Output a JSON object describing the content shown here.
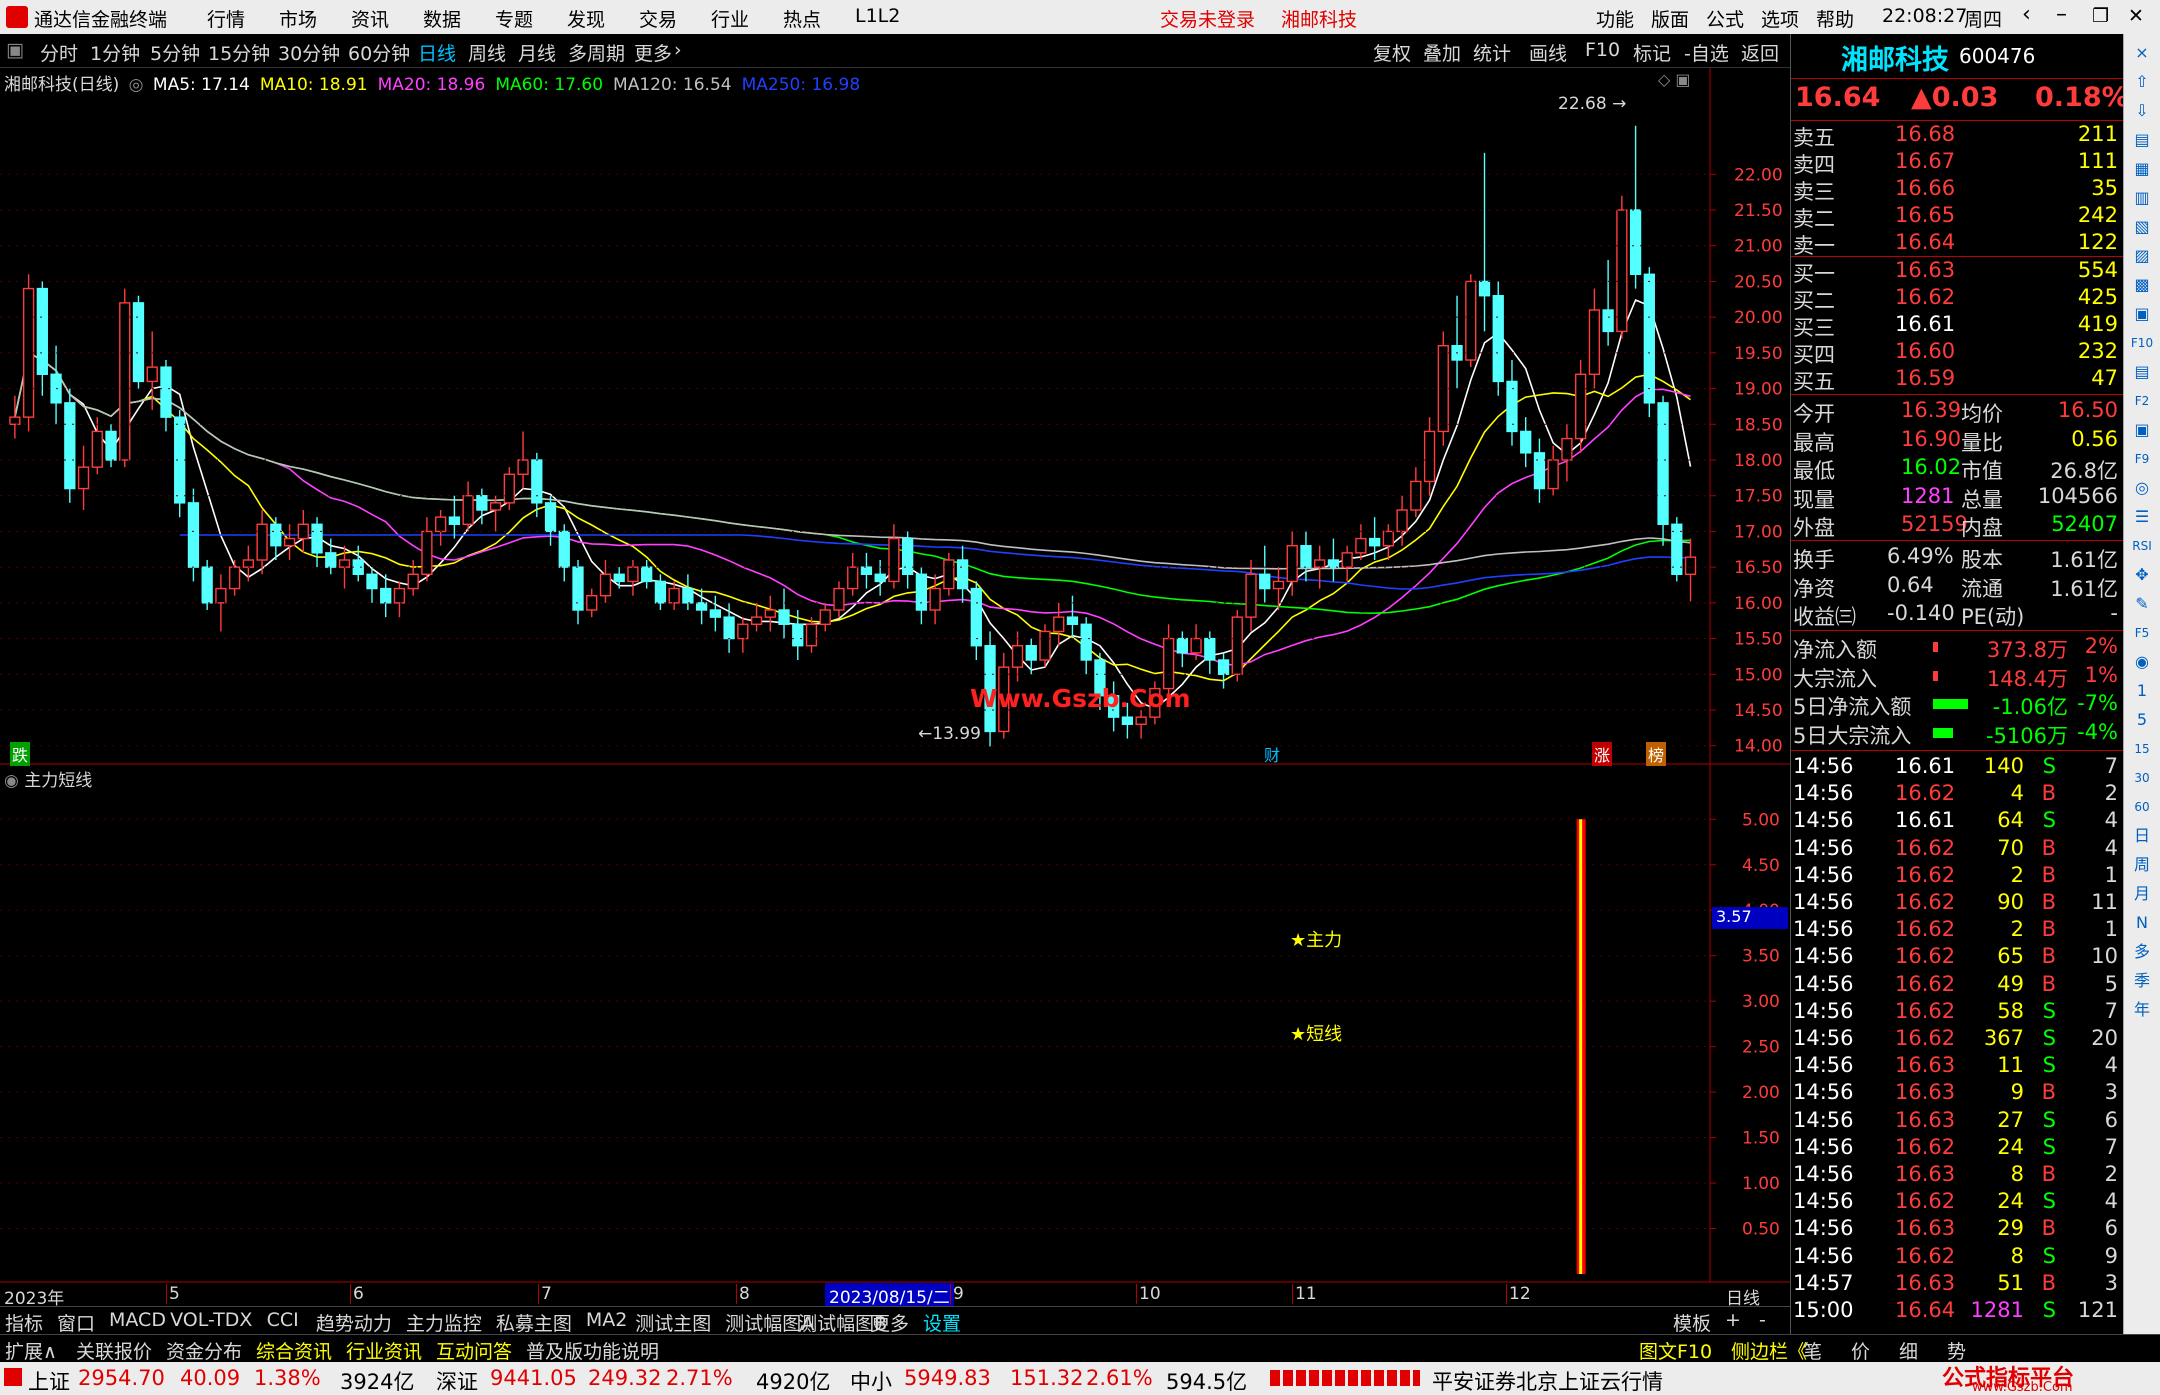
{
  "app": {
    "title": "通达信金融终端",
    "menus": [
      "行情",
      "市场",
      "资讯",
      "数据",
      "专题",
      "发现",
      "交易",
      "行业",
      "热点",
      "L1L2"
    ],
    "trade_status": "交易未登录",
    "stock_name_title": "湘邮科技",
    "right_menus": [
      "功能",
      "版面",
      "公式",
      "选项",
      "帮助"
    ],
    "time": "22:08:27",
    "weekday": "周四"
  },
  "periods": {
    "items": [
      "分时",
      "1分钟",
      "5分钟",
      "15分钟",
      "30分钟",
      "60分钟",
      "日线",
      "周线",
      "月线",
      "多周期",
      "更多"
    ],
    "active": "日线"
  },
  "toolbar_right": [
    "复权",
    "叠加",
    "统计",
    "画线",
    "F10",
    "标记",
    "-自选",
    "返回"
  ],
  "chart_header": {
    "title": "湘邮科技(日线)",
    "ma": [
      {
        "label": "MA5: 17.14",
        "color": "#ffffff"
      },
      {
        "label": "MA10: 18.91",
        "color": "#ffff00"
      },
      {
        "label": "MA20: 18.96",
        "color": "#ff40ff"
      },
      {
        "label": "MA60: 17.60",
        "color": "#00ff00"
      },
      {
        "label": "MA120: 16.54",
        "color": "#c0c0c0"
      },
      {
        "label": "MA250: 16.98",
        "color": "#2040ff"
      }
    ]
  },
  "price_axis": [
    "22.00",
    "21.50",
    "21.00",
    "20.50",
    "20.00",
    "19.50",
    "19.00",
    "18.50",
    "18.00",
    "17.50",
    "17.00",
    "16.50",
    "16.00",
    "15.50",
    "15.00",
    "14.50",
    "14.00"
  ],
  "annotations": {
    "high": "22.68",
    "low": "13.99",
    "watermark": "Www.Gszb.Com",
    "mark_die": "跌",
    "mark_cai": "财",
    "mark_zhang": "涨",
    "mark_bang": "榜"
  },
  "indicator": {
    "title": "主力短线",
    "axis": [
      "5.00",
      "4.50",
      "4.00",
      "3.50",
      "3.00",
      "2.50",
      "2.00",
      "1.50",
      "1.00",
      "0.50"
    ],
    "current": "3.57",
    "label1": "★主力",
    "label2": "★短线"
  },
  "date_axis": {
    "start": "2023年",
    "months": [
      "5",
      "6",
      "7",
      "8",
      "9",
      "10",
      "11",
      "12"
    ],
    "selected": "2023/08/15/二",
    "period_label": "日线"
  },
  "quote": {
    "name": "湘邮科技",
    "code": "600476",
    "price": "16.64",
    "change": "▲0.03",
    "pct": "0.18%",
    "asks": [
      {
        "label": "卖五",
        "price": "16.68",
        "vol": "211"
      },
      {
        "label": "卖四",
        "price": "16.67",
        "vol": "111"
      },
      {
        "label": "卖三",
        "price": "16.66",
        "vol": "35"
      },
      {
        "label": "卖二",
        "price": "16.65",
        "vol": "242"
      },
      {
        "label": "卖一",
        "price": "16.64",
        "vol": "122"
      }
    ],
    "bids": [
      {
        "label": "买一",
        "price": "16.63",
        "vol": "554"
      },
      {
        "label": "买二",
        "price": "16.62",
        "vol": "425"
      },
      {
        "label": "买三",
        "price": "16.61",
        "vol": "419"
      },
      {
        "label": "买四",
        "price": "16.60",
        "vol": "232"
      },
      {
        "label": "买五",
        "price": "16.59",
        "vol": "47"
      }
    ],
    "stats": [
      {
        "l1": "今开",
        "v1": "16.39",
        "c1": "r",
        "l2": "均价",
        "v2": "16.50",
        "c2": "r"
      },
      {
        "l1": "最高",
        "v1": "16.90",
        "c1": "r",
        "l2": "量比",
        "v2": "0.56",
        "c2": "y"
      },
      {
        "l1": "最低",
        "v1": "16.02",
        "c1": "g",
        "l2": "市值",
        "v2": "26.8亿",
        "c2": "w"
      },
      {
        "l1": "现量",
        "v1": "1281",
        "c1": "m",
        "l2": "总量",
        "v2": "104566",
        "c2": "w"
      },
      {
        "l1": "外盘",
        "v1": "52159",
        "c1": "r",
        "l2": "内盘",
        "v2": "52407",
        "c2": "g"
      }
    ],
    "stats2": [
      {
        "l1": "换手",
        "v1": "6.49%",
        "c1": "w",
        "l2": "股本",
        "v2": "1.61亿",
        "c2": "w"
      },
      {
        "l1": "净资",
        "v1": "0.64",
        "c1": "w",
        "l2": "流通",
        "v2": "1.61亿",
        "c2": "w"
      },
      {
        "l1": "收益㈢",
        "v1": "-0.140",
        "c1": "w",
        "l2": "PE(动)",
        "v2": "-",
        "c2": "w"
      }
    ],
    "flows": [
      {
        "label": "净流入额",
        "val": "373.8万",
        "pct": "2%",
        "color": "#ff3c3c",
        "bar": 0.1
      },
      {
        "label": "大宗流入",
        "val": "148.4万",
        "pct": "1%",
        "color": "#ff3c3c",
        "bar": 0.1
      },
      {
        "label": "5日净流入额",
        "val": "-1.06亿",
        "pct": "-7%",
        "color": "#00ff00",
        "bar": 0.7
      },
      {
        "label": "5日大宗流入",
        "val": "-5106万",
        "pct": "-4%",
        "color": "#00ff00",
        "bar": 0.4
      }
    ],
    "ticks": [
      [
        "14:56",
        "16.61",
        "140",
        "S",
        "7"
      ],
      [
        "14:56",
        "16.62",
        "4",
        "B",
        "2"
      ],
      [
        "14:56",
        "16.61",
        "64",
        "S",
        "4"
      ],
      [
        "14:56",
        "16.62",
        "70",
        "B",
        "4"
      ],
      [
        "14:56",
        "16.62",
        "2",
        "B",
        "1"
      ],
      [
        "14:56",
        "16.62",
        "90",
        "B",
        "11"
      ],
      [
        "14:56",
        "16.62",
        "2",
        "B",
        "1"
      ],
      [
        "14:56",
        "16.62",
        "65",
        "B",
        "10"
      ],
      [
        "14:56",
        "16.62",
        "49",
        "B",
        "5"
      ],
      [
        "14:56",
        "16.62",
        "58",
        "S",
        "7"
      ],
      [
        "14:56",
        "16.62",
        "367",
        "S",
        "20"
      ],
      [
        "14:56",
        "16.63",
        "11",
        "S",
        "4"
      ],
      [
        "14:56",
        "16.63",
        "9",
        "B",
        "3"
      ],
      [
        "14:56",
        "16.63",
        "27",
        "S",
        "6"
      ],
      [
        "14:56",
        "16.62",
        "24",
        "S",
        "7"
      ],
      [
        "14:56",
        "16.63",
        "8",
        "B",
        "2"
      ],
      [
        "14:56",
        "16.62",
        "24",
        "S",
        "4"
      ],
      [
        "14:56",
        "16.63",
        "29",
        "B",
        "6"
      ],
      [
        "14:56",
        "16.62",
        "8",
        "S",
        "9"
      ],
      [
        "14:57",
        "16.63",
        "51",
        "B",
        "3"
      ],
      [
        "15:00",
        "16.64",
        "1281",
        "S",
        "121"
      ]
    ]
  },
  "icon_strip": [
    "×",
    "⇧",
    "⇩",
    "▤",
    "▦",
    "▥",
    "▧",
    "▨",
    "▩",
    "▣",
    "F10",
    "▤",
    "F2",
    "▣",
    "F9",
    "◎",
    "☰",
    "RSI",
    "✥",
    "✎",
    "F5",
    "◉",
    "1",
    "5",
    "15",
    "30",
    "60",
    "日",
    "周",
    "月",
    "N",
    "多",
    "季",
    "年"
  ],
  "bottom_tabs": {
    "items": [
      "指标",
      "窗口",
      "MACD",
      "VOL-TDX",
      "CCI",
      "趋势动力",
      "主力监控",
      "私募主图",
      "MA2",
      "测试主图",
      "测试幅图A",
      "测试幅图B",
      "更多",
      "设置"
    ],
    "active": "设置",
    "right": [
      "模板",
      "+",
      "-"
    ]
  },
  "bottom_tabs2": {
    "items": [
      "扩展∧",
      "关联报价",
      "资金分布",
      "综合资讯",
      "行业资讯",
      "互动问答",
      "普及版功能说明"
    ],
    "right": [
      "图文F10",
      "侧边栏《",
      "笔",
      "价",
      "细",
      "势"
    ]
  },
  "status": {
    "sh_label": "上证",
    "sh": "2954.70",
    "sh_chg": "40.09",
    "sh_pct": "1.38%",
    "sh_amt": "3924亿",
    "sz_label": "深证",
    "sz": "9441.05",
    "sz_chg": "249.32",
    "sz_pct": "2.71%",
    "sz_amt": "4920亿",
    "zx_label": "中小",
    "zx": "5949.83",
    "zx_chg": "151.32",
    "zx_pct": "2.61%",
    "zx_amt": "594.5亿",
    "server": "平安证券北京上证云行情",
    "brand": "公式指标平台",
    "brand_url": "www.Gszb.Com"
  },
  "chart_data": {
    "type": "candlestick",
    "title": "湘邮科技(日线)",
    "ylim": [
      13.8,
      22.9
    ],
    "ohlc": [
      [
        18.5,
        18.9,
        18.3,
        18.6
      ],
      [
        18.6,
        20.6,
        18.4,
        20.4
      ],
      [
        20.4,
        20.5,
        18.9,
        19.2
      ],
      [
        19.2,
        19.6,
        18.5,
        18.8
      ],
      [
        18.8,
        19.0,
        17.4,
        17.6
      ],
      [
        17.6,
        18.2,
        17.3,
        17.9
      ],
      [
        17.9,
        18.6,
        17.8,
        18.4
      ],
      [
        18.4,
        18.5,
        17.9,
        18.0
      ],
      [
        18.0,
        20.4,
        17.9,
        20.2
      ],
      [
        20.2,
        20.3,
        19.0,
        19.1
      ],
      [
        19.1,
        19.8,
        18.7,
        19.3
      ],
      [
        19.3,
        19.4,
        18.4,
        18.6
      ],
      [
        18.6,
        18.7,
        17.2,
        17.4
      ],
      [
        17.4,
        17.6,
        16.3,
        16.5
      ],
      [
        16.5,
        16.6,
        15.9,
        16.0
      ],
      [
        16.0,
        16.4,
        15.6,
        16.2
      ],
      [
        16.2,
        16.6,
        16.1,
        16.5
      ],
      [
        16.5,
        16.8,
        16.3,
        16.6
      ],
      [
        16.6,
        17.3,
        16.4,
        17.1
      ],
      [
        17.1,
        17.2,
        16.6,
        16.8
      ],
      [
        16.8,
        17.1,
        16.6,
        16.9
      ],
      [
        16.9,
        17.3,
        16.7,
        17.1
      ],
      [
        17.1,
        17.2,
        16.5,
        16.7
      ],
      [
        16.7,
        16.9,
        16.4,
        16.5
      ],
      [
        16.5,
        16.8,
        16.2,
        16.6
      ],
      [
        16.6,
        16.8,
        16.3,
        16.4
      ],
      [
        16.4,
        16.5,
        16.0,
        16.2
      ],
      [
        16.2,
        16.4,
        15.8,
        16.0
      ],
      [
        16.0,
        16.3,
        15.8,
        16.2
      ],
      [
        16.2,
        16.6,
        16.1,
        16.4
      ],
      [
        16.4,
        17.2,
        16.3,
        17.0
      ],
      [
        17.0,
        17.3,
        16.8,
        17.2
      ],
      [
        17.2,
        17.5,
        16.9,
        17.1
      ],
      [
        17.1,
        17.7,
        17.0,
        17.5
      ],
      [
        17.5,
        17.6,
        17.1,
        17.3
      ],
      [
        17.3,
        17.5,
        17.0,
        17.4
      ],
      [
        17.4,
        17.9,
        17.3,
        17.8
      ],
      [
        17.8,
        18.4,
        17.6,
        18.0
      ],
      [
        18.0,
        18.1,
        17.2,
        17.4
      ],
      [
        17.4,
        17.5,
        16.8,
        17.0
      ],
      [
        17.0,
        17.1,
        16.3,
        16.5
      ],
      [
        16.5,
        16.6,
        15.7,
        15.9
      ],
      [
        15.9,
        16.2,
        15.8,
        16.1
      ],
      [
        16.1,
        16.6,
        16.0,
        16.4
      ],
      [
        16.4,
        16.5,
        16.2,
        16.3
      ],
      [
        16.3,
        16.6,
        16.1,
        16.5
      ],
      [
        16.5,
        16.6,
        16.2,
        16.3
      ],
      [
        16.3,
        16.4,
        15.9,
        16.0
      ],
      [
        16.0,
        16.3,
        15.9,
        16.2
      ],
      [
        16.2,
        16.4,
        15.9,
        16.0
      ],
      [
        16.0,
        16.2,
        15.7,
        15.9
      ],
      [
        15.9,
        16.1,
        15.6,
        15.8
      ],
      [
        15.8,
        16.0,
        15.3,
        15.5
      ],
      [
        15.5,
        15.8,
        15.3,
        15.7
      ],
      [
        15.7,
        16.0,
        15.6,
        15.8
      ],
      [
        15.8,
        16.1,
        15.6,
        15.9
      ],
      [
        15.9,
        16.2,
        15.5,
        15.7
      ],
      [
        15.7,
        15.9,
        15.2,
        15.4
      ],
      [
        15.4,
        15.8,
        15.3,
        15.7
      ],
      [
        15.7,
        16.0,
        15.6,
        15.9
      ],
      [
        15.9,
        16.3,
        15.8,
        16.2
      ],
      [
        16.2,
        16.7,
        16.1,
        16.5
      ],
      [
        16.5,
        16.7,
        16.2,
        16.4
      ],
      [
        16.4,
        16.6,
        16.1,
        16.3
      ],
      [
        16.3,
        17.1,
        16.2,
        16.9
      ],
      [
        16.9,
        17.0,
        16.2,
        16.4
      ],
      [
        16.4,
        16.5,
        15.7,
        15.9
      ],
      [
        15.9,
        16.4,
        15.7,
        16.2
      ],
      [
        16.2,
        16.7,
        16.1,
        16.6
      ],
      [
        16.6,
        16.8,
        16.0,
        16.2
      ],
      [
        16.2,
        16.3,
        15.2,
        15.4
      ],
      [
        15.4,
        15.6,
        13.99,
        14.2
      ],
      [
        14.2,
        15.3,
        14.1,
        15.1
      ],
      [
        15.1,
        15.6,
        14.9,
        15.4
      ],
      [
        15.4,
        15.5,
        15.0,
        15.2
      ],
      [
        15.2,
        15.7,
        15.1,
        15.6
      ],
      [
        15.6,
        16.0,
        15.4,
        15.8
      ],
      [
        15.8,
        16.1,
        15.5,
        15.7
      ],
      [
        15.7,
        15.8,
        15.0,
        15.2
      ],
      [
        15.2,
        15.3,
        14.5,
        14.7
      ],
      [
        14.7,
        14.9,
        14.2,
        14.4
      ],
      [
        14.4,
        14.6,
        14.1,
        14.3
      ],
      [
        14.3,
        14.5,
        14.1,
        14.4
      ],
      [
        14.4,
        14.9,
        14.3,
        14.8
      ],
      [
        14.8,
        15.7,
        14.6,
        15.5
      ],
      [
        15.5,
        15.6,
        15.1,
        15.3
      ],
      [
        15.3,
        15.7,
        15.2,
        15.5
      ],
      [
        15.5,
        15.6,
        15.0,
        15.2
      ],
      [
        15.2,
        15.3,
        14.8,
        15.0
      ],
      [
        15.0,
        15.9,
        14.9,
        15.8
      ],
      [
        15.8,
        16.6,
        15.6,
        16.4
      ],
      [
        16.4,
        16.8,
        16.0,
        16.2
      ],
      [
        16.2,
        16.5,
        15.9,
        16.3
      ],
      [
        16.3,
        17.0,
        16.1,
        16.8
      ],
      [
        16.8,
        17.0,
        16.3,
        16.5
      ],
      [
        16.5,
        16.8,
        16.2,
        16.6
      ],
      [
        16.6,
        16.9,
        16.3,
        16.5
      ],
      [
        16.5,
        16.8,
        16.3,
        16.7
      ],
      [
        16.7,
        17.1,
        16.6,
        16.9
      ],
      [
        16.9,
        17.2,
        16.6,
        16.8
      ],
      [
        16.8,
        17.1,
        16.6,
        17.0
      ],
      [
        17.0,
        17.5,
        16.8,
        17.3
      ],
      [
        17.3,
        17.9,
        17.2,
        17.7
      ],
      [
        17.7,
        18.6,
        17.5,
        18.4
      ],
      [
        18.4,
        19.8,
        18.2,
        19.6
      ],
      [
        19.6,
        20.3,
        19.0,
        19.4
      ],
      [
        19.4,
        20.6,
        19.3,
        20.5
      ],
      [
        20.5,
        22.3,
        19.8,
        20.3
      ],
      [
        20.3,
        20.5,
        18.9,
        19.1
      ],
      [
        19.1,
        19.4,
        18.2,
        18.4
      ],
      [
        18.4,
        18.6,
        17.9,
        18.1
      ],
      [
        18.1,
        18.3,
        17.4,
        17.6
      ],
      [
        17.6,
        18.2,
        17.5,
        18.0
      ],
      [
        18.0,
        18.5,
        17.7,
        18.3
      ],
      [
        18.3,
        19.4,
        18.1,
        19.2
      ],
      [
        19.2,
        20.4,
        19.0,
        20.1
      ],
      [
        20.1,
        20.8,
        19.6,
        19.8
      ],
      [
        19.8,
        21.7,
        19.7,
        21.5
      ],
      [
        21.5,
        22.68,
        20.4,
        20.6
      ],
      [
        20.6,
        20.7,
        18.6,
        18.8
      ],
      [
        18.8,
        18.9,
        16.8,
        17.1
      ],
      [
        17.1,
        17.2,
        16.3,
        16.4
      ],
      [
        16.4,
        16.9,
        16.02,
        16.64
      ]
    ],
    "indicator": {
      "name": "主力短线",
      "ylim": [
        0,
        5.3
      ],
      "bar_index": 114,
      "bar_value": 5.0
    }
  }
}
